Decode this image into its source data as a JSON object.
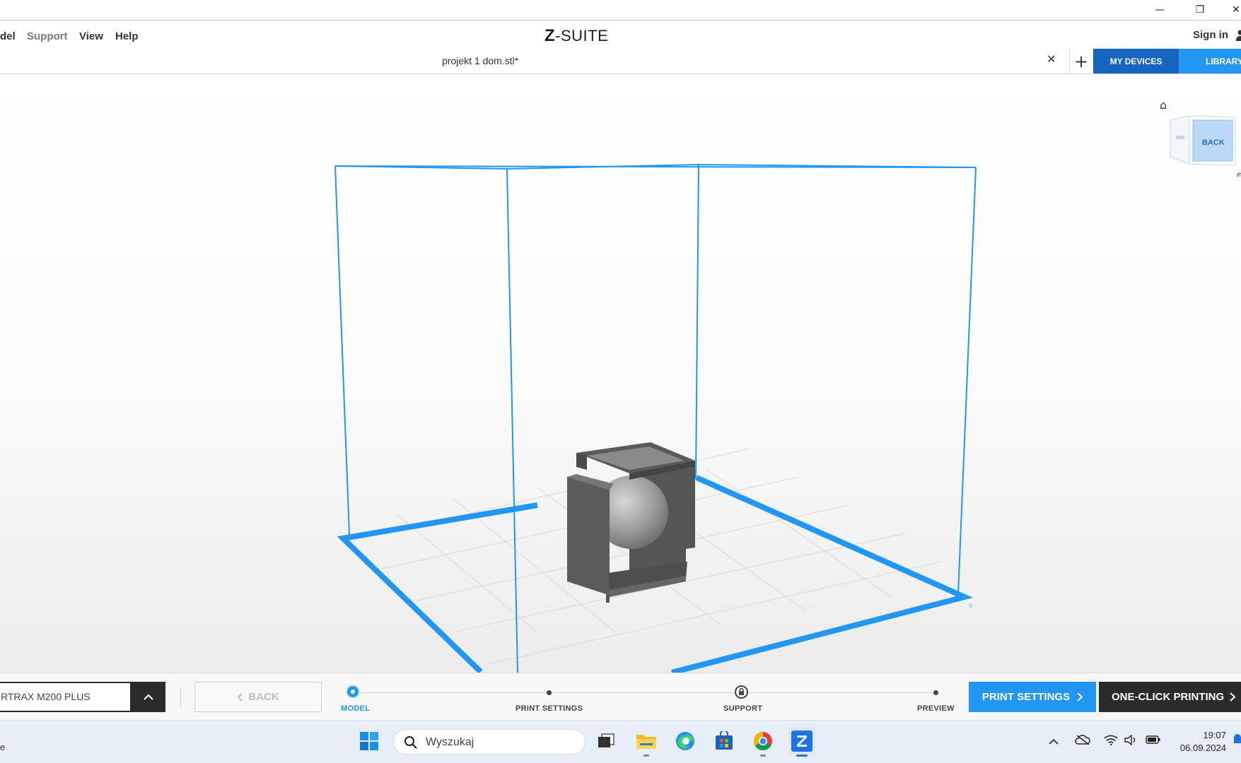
{
  "window": {
    "minimize_glyph": "—",
    "restore_glyph": "❐",
    "close_glyph": "✕"
  },
  "menu": {
    "items": [
      "del",
      "Support",
      "View",
      "Help"
    ],
    "logo_mark": "Z",
    "logo_text": "-SUITE",
    "sign_in": "Sign in"
  },
  "tabs": {
    "active": "projekt 1 dom.stl*",
    "close_glyph": "✕",
    "add_glyph": "+",
    "my_devices": "MY DEVICES",
    "library": "LIBRARY"
  },
  "viewport": {
    "navcube_face": "BACK",
    "home_icon": "home-icon",
    "accent_color": "#2196f3"
  },
  "bottom": {
    "printer": "RTRAX M200 PLUS",
    "back": "BACK",
    "steps": [
      {
        "label": "MODEL",
        "active": true
      },
      {
        "label": "PRINT SETTINGS",
        "active": false
      },
      {
        "label": "SUPPORT",
        "active": false
      },
      {
        "label": "PREVIEW",
        "active": false
      }
    ],
    "print_settings": "PRINT SETTINGS",
    "one_click": "ONE-CLICK PRINTING"
  },
  "taskbar": {
    "edge_text": "e",
    "search_placeholder": "Wyszukaj",
    "time": "19:07",
    "date": "06.09.2024"
  }
}
